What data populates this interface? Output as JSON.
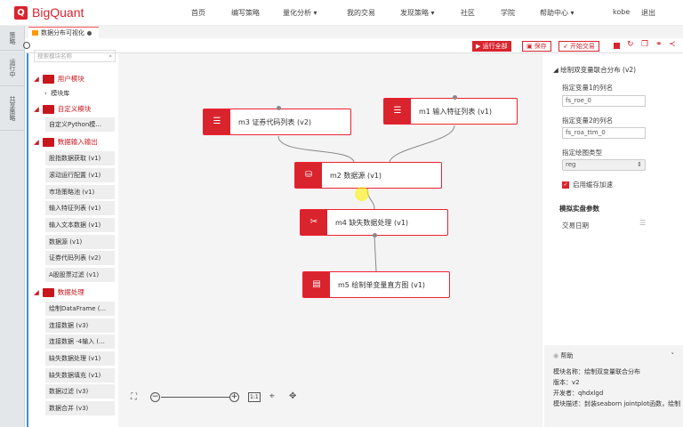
{
  "brand": "BigQuant",
  "nav": [
    "首页",
    "编写策略",
    "量化分析 ▾",
    "我的交易",
    "发现策略 ▾",
    "社区",
    "学院",
    "帮助中心 ▾"
  ],
  "user": "kobe",
  "logout": "退出",
  "side_tabs": [
    "策略",
    "运行中",
    "共享策略"
  ],
  "tab": {
    "title": "数据分布可视化"
  },
  "toolbar": {
    "run_all": "▶ 运行全部",
    "save": "保存",
    "start_trade": "开始交易"
  },
  "search": {
    "placeholder": "搜索模块名称"
  },
  "tree": [
    {
      "label": "用户模块",
      "items": [
        "模块库"
      ]
    },
    {
      "label": "自定义模块",
      "items": [
        "自定义Python模..."
      ]
    },
    {
      "label": "数据输入输出",
      "items": [
        "股指数据获取 (v1)",
        "滚动运行配置 (v1)",
        "市场策略池 (v1)",
        "输入特征列表 (v1)",
        "输入文本数据 (v1)",
        "数据源 (v1)",
        "证券代码列表 (v2)",
        "A股股票过滤 (v1)"
      ]
    },
    {
      "label": "数据处理",
      "items": [
        "绘制DataFrame (...",
        "连接数据 (v3)",
        "连接数据 -4输入 (...",
        "缺失数据处理 (v1)",
        "缺失数据填充 (v1)",
        "数据过滤 (v3)",
        "数据合并 (v3)"
      ]
    }
  ],
  "nodes": {
    "m3": "m3 证券代码列表 (v2)",
    "m1": "m1 输入特征列表 (v1)",
    "m2": "m2 数据源 (v1)",
    "m4": "m4 缺失数据处理 (v1)",
    "m5": "m5 绘制单变量直方图 (v1)"
  },
  "zoom_controls": {
    "ratio": "1:1"
  },
  "props": {
    "title": "绘制双变量联合分布 (v2)",
    "var1_label": "指定变量1的列名",
    "var1": "fs_roe_0",
    "var2_label": "指定变量2的列名",
    "var2": "fs_roa_ttm_0",
    "plot_label": "指定绘图类型",
    "plot": "reg",
    "cache": "启用缓存加速",
    "sim_title": "模拟实盘参数",
    "trade_date": "交易日期"
  },
  "help": {
    "title": "帮助",
    "name": "模块名称：绘制双变量联合分布",
    "version": "版本：v2",
    "dev": "开发者：qhdxlgd",
    "desc": "模块描述：封装seaborn jointplot函数，绘制"
  },
  "colors": {
    "accent": "#d9232d",
    "blue": "#3a8ee6"
  }
}
